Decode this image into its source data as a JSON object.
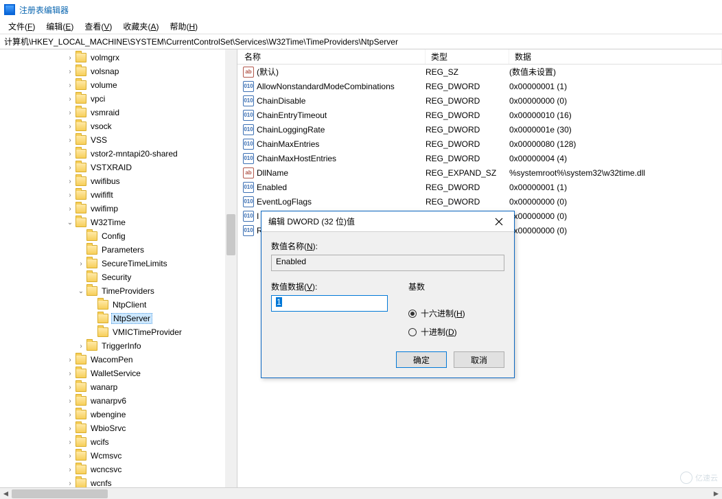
{
  "window": {
    "title": "注册表编辑器"
  },
  "menu": {
    "file": "文件",
    "file_u": "F",
    "edit": "编辑",
    "edit_u": "E",
    "view": "查看",
    "view_u": "V",
    "fav": "收藏夹",
    "fav_u": "A",
    "help": "帮助",
    "help_u": "H"
  },
  "address": {
    "label": "计算机",
    "path": "\\HKEY_LOCAL_MACHINE\\SYSTEM\\CurrentControlSet\\Services\\W32Time\\TimeProviders\\NtpServer"
  },
  "columns": {
    "name": "名称",
    "type": "类型",
    "data": "数据"
  },
  "tree": [
    {
      "d": 6,
      "tw": ">",
      "label": "volmgrx"
    },
    {
      "d": 6,
      "tw": ">",
      "label": "volsnap"
    },
    {
      "d": 6,
      "tw": ">",
      "label": "volume"
    },
    {
      "d": 6,
      "tw": ">",
      "label": "vpci"
    },
    {
      "d": 6,
      "tw": ">",
      "label": "vsmraid"
    },
    {
      "d": 6,
      "tw": ">",
      "label": "vsock"
    },
    {
      "d": 6,
      "tw": ">",
      "label": "VSS"
    },
    {
      "d": 6,
      "tw": ">",
      "label": "vstor2-mntapi20-shared"
    },
    {
      "d": 6,
      "tw": ">",
      "label": "VSTXRAID"
    },
    {
      "d": 6,
      "tw": ">",
      "label": "vwifibus"
    },
    {
      "d": 6,
      "tw": ">",
      "label": "vwififlt"
    },
    {
      "d": 6,
      "tw": ">",
      "label": "vwifimp"
    },
    {
      "d": 6,
      "tw": "v",
      "label": "W32Time"
    },
    {
      "d": 7,
      "tw": "",
      "label": "Config"
    },
    {
      "d": 7,
      "tw": "",
      "label": "Parameters"
    },
    {
      "d": 7,
      "tw": ">",
      "label": "SecureTimeLimits"
    },
    {
      "d": 7,
      "tw": "",
      "label": "Security"
    },
    {
      "d": 7,
      "tw": "v",
      "label": "TimeProviders"
    },
    {
      "d": 8,
      "tw": "",
      "label": "NtpClient"
    },
    {
      "d": 8,
      "tw": "",
      "label": "NtpServer",
      "sel": true
    },
    {
      "d": 8,
      "tw": "",
      "label": "VMICTimeProvider"
    },
    {
      "d": 7,
      "tw": ">",
      "label": "TriggerInfo"
    },
    {
      "d": 6,
      "tw": ">",
      "label": "WacomPen"
    },
    {
      "d": 6,
      "tw": ">",
      "label": "WalletService"
    },
    {
      "d": 6,
      "tw": ">",
      "label": "wanarp"
    },
    {
      "d": 6,
      "tw": ">",
      "label": "wanarpv6"
    },
    {
      "d": 6,
      "tw": ">",
      "label": "wbengine"
    },
    {
      "d": 6,
      "tw": ">",
      "label": "WbioSrvc"
    },
    {
      "d": 6,
      "tw": ">",
      "label": "wcifs"
    },
    {
      "d": 6,
      "tw": ">",
      "label": "Wcmsvc"
    },
    {
      "d": 6,
      "tw": ">",
      "label": "wcncsvc"
    },
    {
      "d": 6,
      "tw": ">",
      "label": "wcnfs"
    }
  ],
  "values": [
    {
      "icon": "str",
      "name": "(默认)",
      "type": "REG_SZ",
      "data": "(数值未设置)"
    },
    {
      "icon": "bin",
      "name": "AllowNonstandardModeCombinations",
      "type": "REG_DWORD",
      "data": "0x00000001 (1)"
    },
    {
      "icon": "bin",
      "name": "ChainDisable",
      "type": "REG_DWORD",
      "data": "0x00000000 (0)"
    },
    {
      "icon": "bin",
      "name": "ChainEntryTimeout",
      "type": "REG_DWORD",
      "data": "0x00000010 (16)"
    },
    {
      "icon": "bin",
      "name": "ChainLoggingRate",
      "type": "REG_DWORD",
      "data": "0x0000001e (30)"
    },
    {
      "icon": "bin",
      "name": "ChainMaxEntries",
      "type": "REG_DWORD",
      "data": "0x00000080 (128)"
    },
    {
      "icon": "bin",
      "name": "ChainMaxHostEntries",
      "type": "REG_DWORD",
      "data": "0x00000004 (4)"
    },
    {
      "icon": "str",
      "name": "DllName",
      "type": "REG_EXPAND_SZ",
      "data": "%systemroot%\\system32\\w32time.dll"
    },
    {
      "icon": "bin",
      "name": "Enabled",
      "type": "REG_DWORD",
      "data": "0x00000001 (1)"
    },
    {
      "icon": "bin",
      "name": "EventLogFlags",
      "type": "REG_DWORD",
      "data": "0x00000000 (0)"
    },
    {
      "icon": "bin",
      "name": "I",
      "type": "REG_DWORD",
      "data": "0x00000000 (0)",
      "partial_name": true
    },
    {
      "icon": "bin",
      "name": "R",
      "type": "REG_DWORD",
      "data": "0x00000000 (0)",
      "partial_name": true
    }
  ],
  "dialog": {
    "title": "编辑 DWORD (32 位)值",
    "name_label": "数值名称(",
    "name_u": "N",
    "name_label2": "):",
    "name_value": "Enabled",
    "data_label": "数值数据(",
    "data_u": "V",
    "data_label2": "):",
    "data_value": "1",
    "base_label": "基数",
    "radio_hex": "十六进制(",
    "radio_hex_u": "H",
    "radio_hex2": ")",
    "radio_dec": "十进制(",
    "radio_dec_u": "D",
    "radio_dec2": ")",
    "base_selected": "hex",
    "ok": "确定",
    "cancel": "取消"
  },
  "watermark": "亿速云",
  "icon_text": {
    "str": "ab",
    "bin": "010"
  }
}
